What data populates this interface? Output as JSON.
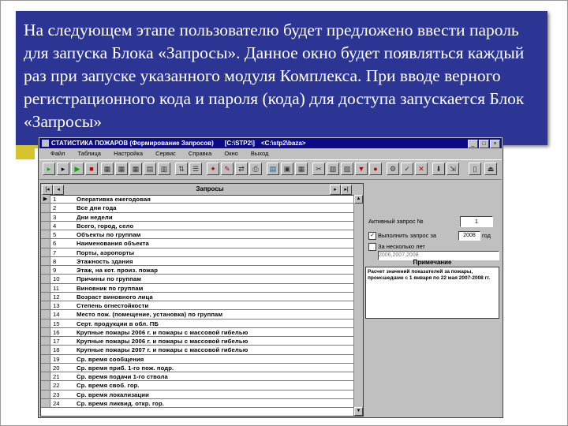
{
  "caption": "На следующем этапе пользователю будет предложено ввести пароль для запуска Блока «Запросы». Данное окно будет появляться каждый раз при запуске указанного модуля Комплекса. При вводе верного регистрационного кода и пароля (кода) для доступа запускается Блок «Запросы»",
  "window": {
    "title": "СТАТИСТИКА ПОЖАРОВ (Формирование Запросов)",
    "path1": "[C:\\STP2\\]",
    "path2": "<C:\\stp2\\baza>",
    "controls": [
      "_",
      "□",
      "×"
    ]
  },
  "menu": [
    "Файл",
    "Таблица",
    "Настройка",
    "Сервис",
    "Справка",
    "Окно",
    "Выход"
  ],
  "grid": {
    "header": "Запросы",
    "rows": [
      {
        "n": "1",
        "name": "Оперативка ежегодовая"
      },
      {
        "n": "2",
        "name": "Все дни года"
      },
      {
        "n": "3",
        "name": "Дни недели"
      },
      {
        "n": "4",
        "name": "Всего, город, село"
      },
      {
        "n": "5",
        "name": "Объекты по группам"
      },
      {
        "n": "6",
        "name": "Наименования объекта"
      },
      {
        "n": "7",
        "name": "Порты, аэропорты"
      },
      {
        "n": "8",
        "name": "Этажность здания"
      },
      {
        "n": "9",
        "name": "Этаж, на кот. произ. пожар"
      },
      {
        "n": "10",
        "name": "Причины по группам"
      },
      {
        "n": "11",
        "name": "Виновник по группам"
      },
      {
        "n": "12",
        "name": "Возраст виновного лица"
      },
      {
        "n": "13",
        "name": "Степень огнестойкости"
      },
      {
        "n": "14",
        "name": "Место пож. (помещение, установка) по группам"
      },
      {
        "n": "15",
        "name": "Серт. продукции в обл. ПБ"
      },
      {
        "n": "16",
        "name": "Крупные пожары 2006 г. и пожары с массовой гибелью"
      },
      {
        "n": "17",
        "name": "Крупные пожары 2006 г. и пожары с массовой гибелью"
      },
      {
        "n": "18",
        "name": "Крупные пожары 2007 г. и пожары с массовой гибелью"
      },
      {
        "n": "19",
        "name": "Ср. время сообщения"
      },
      {
        "n": "20",
        "name": "Ср. время приб. 1-го пож. подр."
      },
      {
        "n": "21",
        "name": "Ср. время подачи 1-го ствола"
      },
      {
        "n": "22",
        "name": "Ср. время своб. гор."
      },
      {
        "n": "23",
        "name": "Ср. время локализации"
      },
      {
        "n": "24",
        "name": "Ср. время ликвид. откр. гор."
      }
    ]
  },
  "panel": {
    "active_label": "Активный запрос №",
    "active_value": "1",
    "run_label": "Выполнить запрос за",
    "year": "2008",
    "year_suffix": "год",
    "several_label": "За несколько лет",
    "years_range": "2006,2007,2008",
    "note_title": "Примечание",
    "note_text": "Расчет значений показателей за пожары, происшедшие с 1 января по 22 мая 2007-2008 гг."
  },
  "colors": {
    "caption_bg": "#2d3594",
    "titlebar_bg": "#0b0b86",
    "window_bg": "#c0c0c0",
    "accent": "#d6c42e"
  }
}
